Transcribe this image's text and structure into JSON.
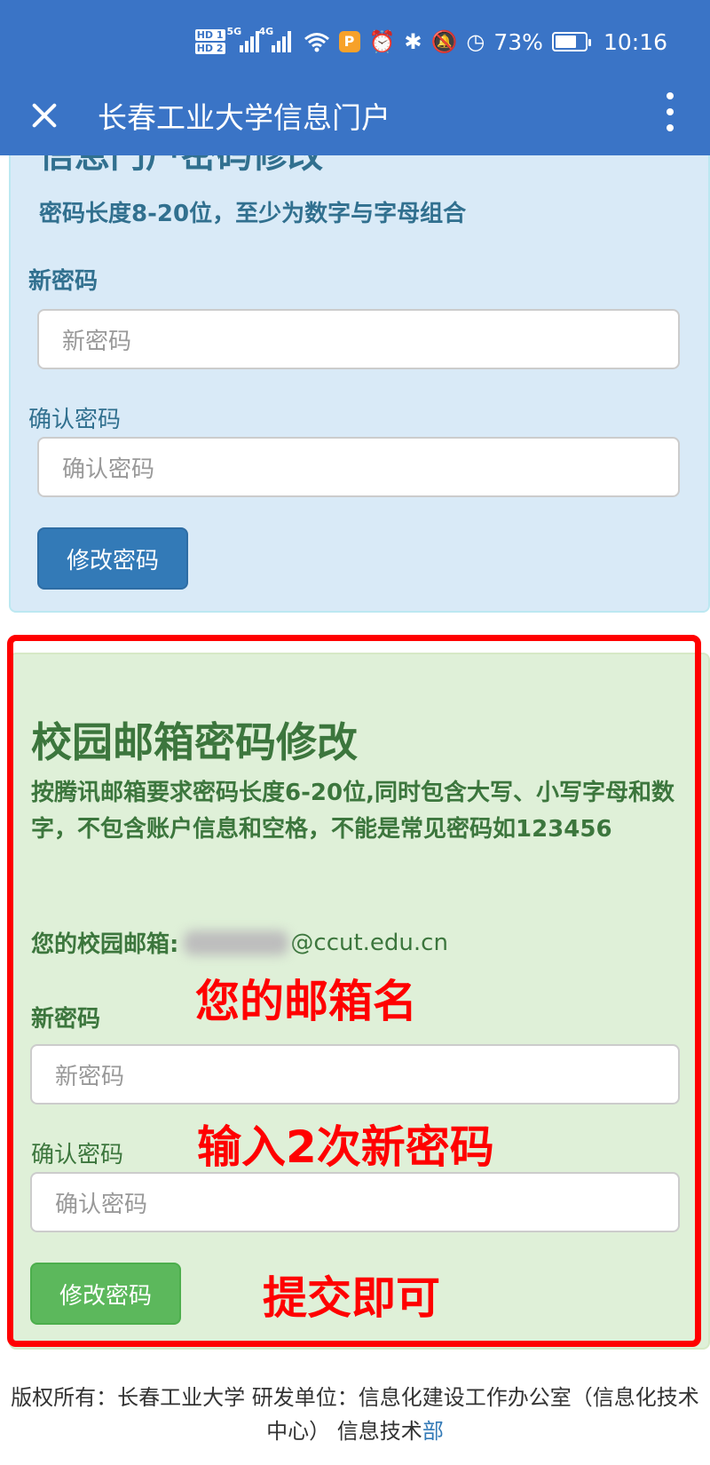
{
  "status_bar": {
    "hd1": "HD 1",
    "hd2": "HD 2",
    "net1": "5G",
    "net2": "4G",
    "app_badge": "P",
    "battery_percent": "73%",
    "battery_level": 0.73,
    "time": "10:16"
  },
  "app_bar": {
    "title": "长春工业大学信息门户"
  },
  "portal_panel": {
    "title_cut": "信息门户密码修改",
    "note": "密码长度8-20位，至少为数字与字母组合",
    "new_label": "新密码",
    "new_placeholder": "新密码",
    "confirm_label": "确认密码",
    "confirm_placeholder": "确认密码",
    "submit_label": "修改密码"
  },
  "mail_panel": {
    "title": "校园邮箱密码修改",
    "note": "按腾讯邮箱要求密码长度6-20位,同时包含大写、小写字母和数字，不包含账户信息和空格，不能是常见密码如123456",
    "mail_label": "您的校园邮箱:",
    "mail_domain": "@ccut.edu.cn",
    "new_label": "新密码",
    "new_placeholder": "新密码",
    "confirm_label": "确认密码",
    "confirm_placeholder": "确认密码",
    "submit_label": "修改密码"
  },
  "annotations": {
    "a1": "您的邮箱名",
    "a2": "输入2次新密码",
    "a3": "提交即可"
  },
  "footer": {
    "text": "版权所有：长春工业大学 研发单位：信息化建设工作办公室（信息化技术中心） 信息技术",
    "link": "部"
  },
  "colors": {
    "app_bar": "#3a74c6",
    "blue_panel": "#d9eaf7",
    "green_panel": "#dff0d8",
    "annotation": "#ff0000"
  }
}
